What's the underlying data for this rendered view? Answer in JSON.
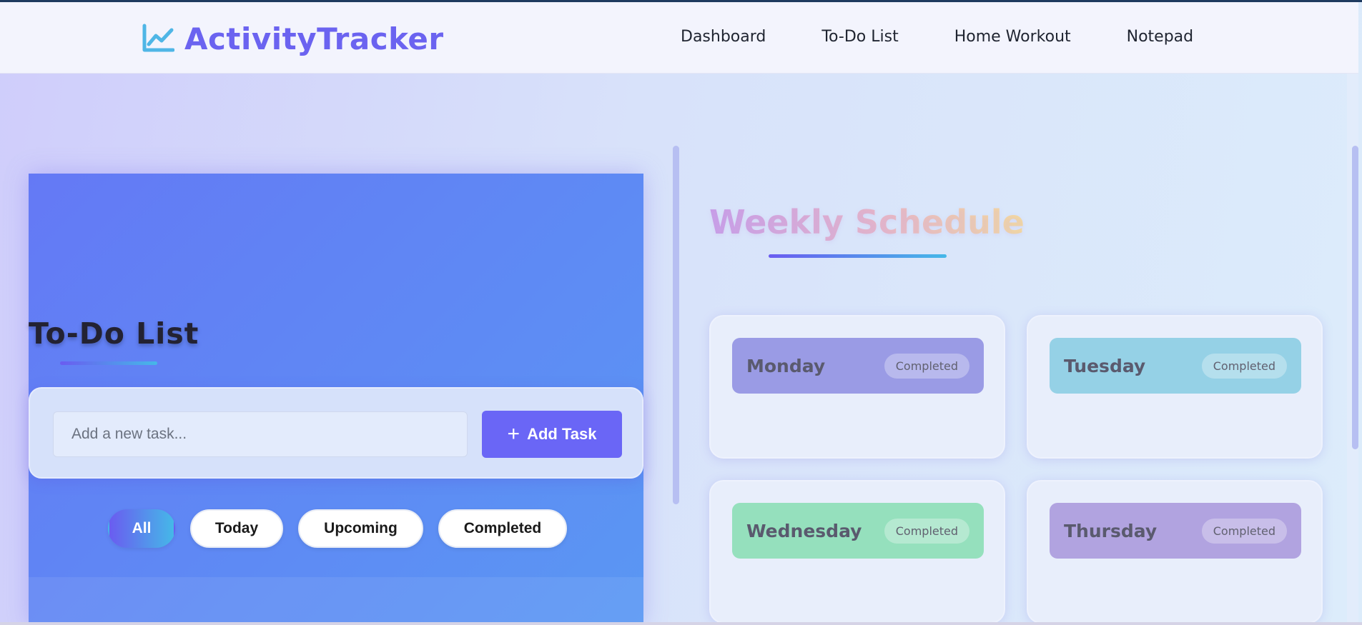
{
  "brand": {
    "name": "ActivityTracker",
    "icon": "chart-line-icon"
  },
  "nav": {
    "items": [
      "Dashboard",
      "To-Do List",
      "Home Workout",
      "Notepad"
    ]
  },
  "todo": {
    "title": "To-Do List",
    "input_placeholder": "Add a new task...",
    "input_value": "",
    "add_button_label": "Add Task",
    "add_button_icon": "plus-icon",
    "filters": [
      "All",
      "Today",
      "Upcoming",
      "Completed"
    ],
    "active_filter": "All"
  },
  "schedule": {
    "title": "Weekly Schedule",
    "days": [
      {
        "name": "Monday",
        "status": "Completed",
        "color": "#9a9be5"
      },
      {
        "name": "Tuesday",
        "status": "Completed",
        "color": "#95d1e6"
      },
      {
        "name": "Wednesday",
        "status": "Completed",
        "color": "#95e0bd"
      },
      {
        "name": "Thursday",
        "status": "Completed",
        "color": "#b1a3e0"
      }
    ]
  },
  "colors": {
    "accent": "#6a66f6",
    "brand_text": "#6b63f0",
    "gradient_start": "#6a5cf0",
    "gradient_end": "#45b8e8"
  }
}
